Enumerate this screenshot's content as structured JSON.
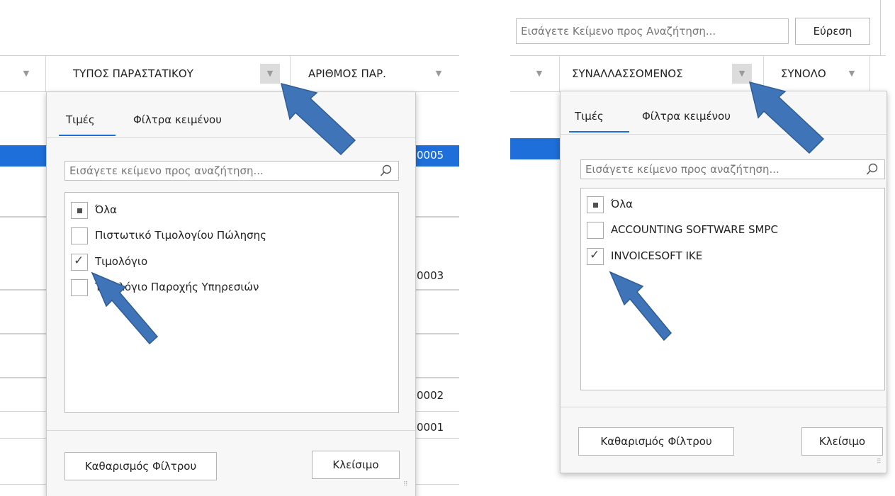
{
  "left": {
    "header": {
      "filter_col_icon": "filter-icon",
      "doc_type_label": "ΤΥΠΟΣ ΠΑΡΑΣΤΑΤΙΚΟΥ",
      "doc_number_label": "ΑΡΙΘΜΟΣ ΠΑΡ."
    },
    "rows": [
      "0005",
      "0003",
      "0002",
      "0001"
    ],
    "popup": {
      "tabs": [
        "Τιμές",
        "Φίλτρα κειμένου"
      ],
      "search_placeholder": "Εισάγετε κείμενο προς αναζήτηση...",
      "items": [
        {
          "label": "Όλα",
          "state": "indeterminate"
        },
        {
          "label": "Πιστωτικό Τιμολογίου Πώλησης",
          "state": "unchecked"
        },
        {
          "label": "Τιμολόγιο",
          "state": "checked"
        },
        {
          "label": "Τιμολόγιο Παροχής Υπηρεσιών",
          "state": "unchecked"
        }
      ],
      "clear_label": "Καθαρισμός Φίλτρου",
      "close_label": "Κλείσιμο"
    }
  },
  "right": {
    "top_search": {
      "placeholder": "Εισάγετε Κείμενο προς Αναζήτηση...",
      "find_label": "Εύρεση"
    },
    "header": {
      "counterparty_label": "ΣΥΝΑΛΛΑΣΣΟΜΕΝΟΣ",
      "total_label": "ΣΥΝΟΛΟ"
    },
    "popup": {
      "tabs": [
        "Τιμές",
        "Φίλτρα κειμένου"
      ],
      "search_placeholder": "Εισάγετε κείμενο προς αναζήτηση...",
      "items": [
        {
          "label": "Όλα",
          "state": "indeterminate"
        },
        {
          "label": "ACCOUNTING SOFTWARE SMPC",
          "state": "unchecked"
        },
        {
          "label": "INVOICESOFT IKE",
          "state": "checked"
        }
      ],
      "clear_label": "Καθαρισμός Φίλτρου",
      "close_label": "Κλείσιμο"
    }
  },
  "colors": {
    "selection": "#1e6fd9",
    "arrow": "#3f75b8",
    "arrow_outline": "#2f5d93"
  }
}
